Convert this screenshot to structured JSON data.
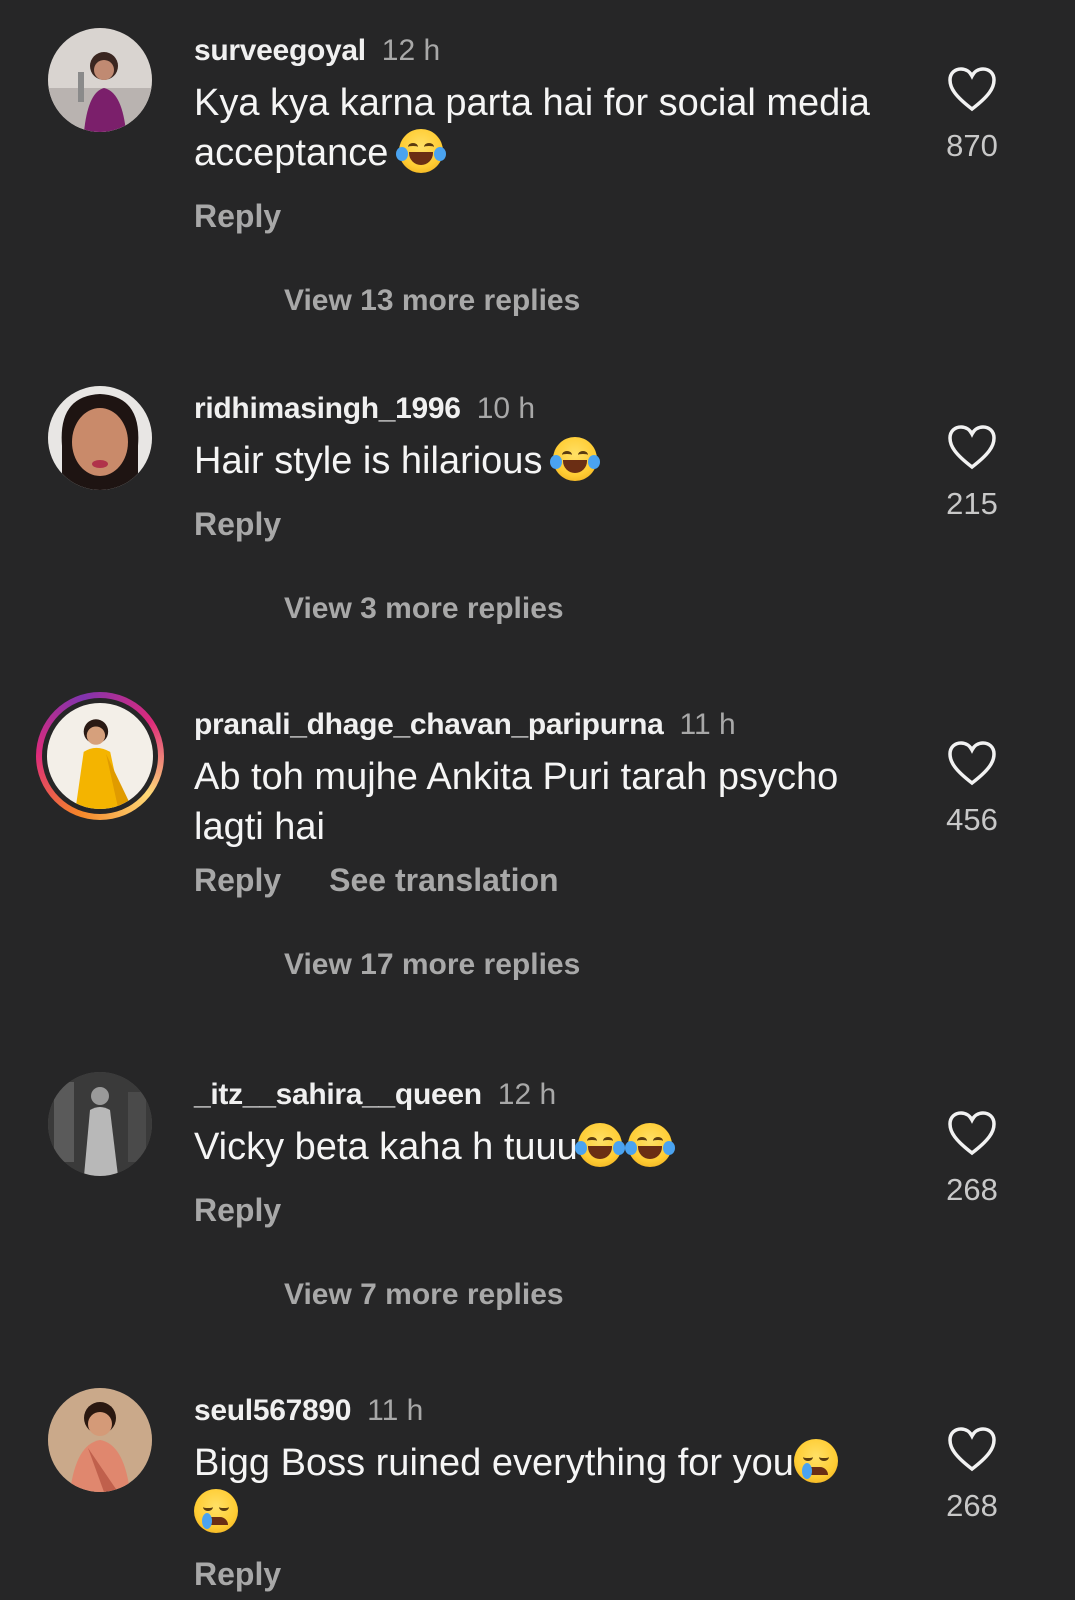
{
  "colors": {
    "background": "#262627",
    "text": "#f5f5f5",
    "muted": "#a8a8a8"
  },
  "comments": [
    {
      "username": "surveegoyal",
      "time": "12 h",
      "text": "Kya kya karna parta hai for social media acceptance",
      "emojis": [
        "face-with-tears-of-joy"
      ],
      "reply_label": "Reply",
      "likes": "870",
      "view_replies": "View 13 more replies"
    },
    {
      "username": "ridhimasingh_1996",
      "time": "10 h",
      "text": "Hair style is hilarious",
      "emojis": [
        "face-with-tears-of-joy"
      ],
      "reply_label": "Reply",
      "likes": "215",
      "view_replies": "View 3 more replies"
    },
    {
      "username": "pranali_dhage_chavan_paripurna",
      "time": "11 h",
      "text": "Ab toh mujhe Ankita Puri tarah psycho lagti hai",
      "emojis": [],
      "reply_label": "Reply",
      "translation_label": "See translation",
      "likes": "456",
      "view_replies": "View 17 more replies"
    },
    {
      "username": "_itz__sahira__queen",
      "time": "12 h",
      "text": "Vicky beta kaha h tuuu",
      "emojis": [
        "face-with-tears-of-joy",
        "face-with-tears-of-joy"
      ],
      "reply_label": "Reply",
      "likes": "268",
      "view_replies": "View 7 more replies"
    },
    {
      "username": "seul567890",
      "time": "11 h",
      "text": "Bigg Boss ruined everything for you",
      "emojis": [
        "crying-face",
        "crying-face"
      ],
      "reply_label": "Reply",
      "likes": "268"
    }
  ]
}
